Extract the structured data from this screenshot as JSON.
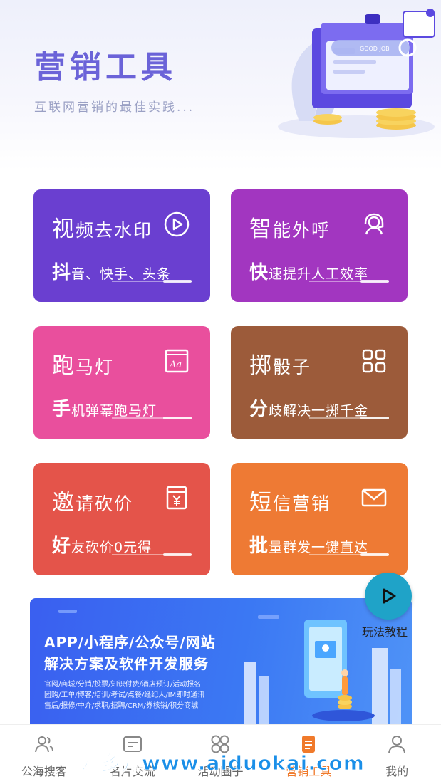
{
  "header": {
    "title": "营销工具",
    "subtitle": "互联网营销的最佳实践...",
    "illustration_badge": "GOOD JOB"
  },
  "cards": [
    {
      "id": "video-watermark",
      "title_first": "视",
      "title_rest": "频去水印",
      "sub_first": "抖",
      "sub_rest": "音、快手、头条",
      "icon": "play-circle-icon",
      "color": "#6a3fd0"
    },
    {
      "id": "smart-call",
      "title_first": "智",
      "title_rest": "能外呼",
      "sub_first": "快",
      "sub_rest": "速提升人工效率",
      "icon": "headset-agent-icon",
      "color": "#a236c0"
    },
    {
      "id": "marquee",
      "title_first": "跑",
      "title_rest": "马灯",
      "sub_first": "手",
      "sub_rest": "机弹幕跑马灯",
      "icon": "text-font-icon",
      "color": "#e94f9d"
    },
    {
      "id": "dice",
      "title_first": "掷",
      "title_rest": "骰子",
      "sub_first": "分",
      "sub_rest": "歧解决一掷千金",
      "icon": "grid-four-icon",
      "color": "#9c5b3a"
    },
    {
      "id": "bargain",
      "title_first": "邀",
      "title_rest": "请砍价",
      "sub_first": "好",
      "sub_rest": "友砍价0元得",
      "icon": "yen-voucher-icon",
      "color": "#e4544a"
    },
    {
      "id": "sms",
      "title_first": "短",
      "title_rest": "信营销",
      "sub_first": "批",
      "sub_rest": "量群发一键直达",
      "icon": "envelope-icon",
      "color": "#ee7a34"
    }
  ],
  "tutorial": {
    "label": "玩法教程",
    "icon": "play-triangle-icon"
  },
  "banner": {
    "line1": "APP/小程序/公众号/网站",
    "line2": "解决方案及软件开发服务",
    "line3": "官网/商城/分销/投票/知识付费/酒店预订/活动报名",
    "line4": "团购/工单/博客/培训/考试/点餐/经纪人/IM即时通讯",
    "line5": "售后/报修/中介/求职/招聘/CRM/券核销/积分商城"
  },
  "tabs": [
    {
      "label": "公海搜客",
      "icon": "people-icon",
      "active": false
    },
    {
      "label": "名片交流",
      "icon": "card-icon",
      "active": false
    },
    {
      "label": "活动圈子",
      "icon": "circles-icon",
      "active": false
    },
    {
      "label": "营销工具",
      "icon": "clipboard-icon",
      "active": true
    },
    {
      "label": "我的",
      "icon": "user-icon",
      "active": false
    }
  ],
  "watermark": "爱多开www.aiduokai.com",
  "colors": {
    "accent": "#f07a2b",
    "header_title": "#6b63d8",
    "banner": "#3b6ef2"
  }
}
